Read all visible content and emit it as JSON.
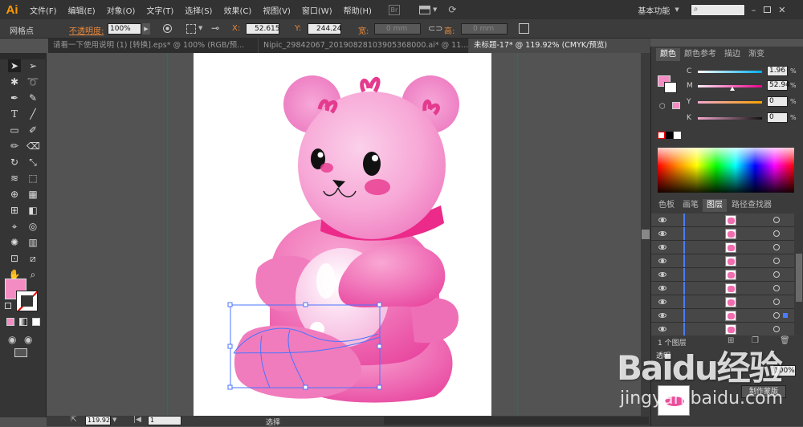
{
  "app": {
    "logo": "Ai"
  },
  "menu": [
    "文件(F)",
    "编辑(E)",
    "对象(O)",
    "文字(T)",
    "选择(S)",
    "效果(C)",
    "视图(V)",
    "窗口(W)",
    "帮助(H)"
  ],
  "workspace": {
    "label": "基本功能",
    "search_placeholder": ""
  },
  "control": {
    "selection_label": "网格点",
    "opacity_label": "不透明度:",
    "opacity_value": "100%",
    "x_label": "X:",
    "x_value": "52.615",
    "y_label": "Y:",
    "y_value": "244.24",
    "w_label": "宽:",
    "w_value": "0 mm",
    "h_label": "高:",
    "h_value": "0 mm"
  },
  "tabs": [
    {
      "label": "请看一下使用说明 (1) [转换].eps* @ 100% (RGB/预..."
    },
    {
      "label": "Nipic_29842067_20190828103905368000.ai* @ 11..."
    },
    {
      "label": "未标题-17* @ 119.92% (CMYK/预览)"
    }
  ],
  "status": {
    "zoom": "119.92",
    "page": "1",
    "tool": "选择"
  },
  "color_panel": {
    "tabs": [
      "颜色",
      "颜色参考",
      "描边",
      "渐变"
    ],
    "channels": [
      {
        "name": "C",
        "value": "1.96",
        "pos": 0.02,
        "color": "#00aeef"
      },
      {
        "name": "M",
        "value": "52.94",
        "pos": 0.53,
        "color": "#ec008c"
      },
      {
        "name": "Y",
        "value": "0",
        "pos": 0.0,
        "color": "#fff200"
      },
      {
        "name": "K",
        "value": "0",
        "pos": 0.0,
        "color": "#231f20"
      }
    ],
    "fill_color": "#f48cc4"
  },
  "layers_panel": {
    "tabs": [
      "色板",
      "画笔",
      "图层",
      "路径查找器"
    ],
    "row_count": 9,
    "footer": "1 个图层"
  },
  "bottom_panel": {
    "label": "透明",
    "opacity": "100%",
    "button": "制作蒙版"
  },
  "watermark": {
    "brand": "Baidu经验",
    "url": "jingyan.baidu.com"
  }
}
